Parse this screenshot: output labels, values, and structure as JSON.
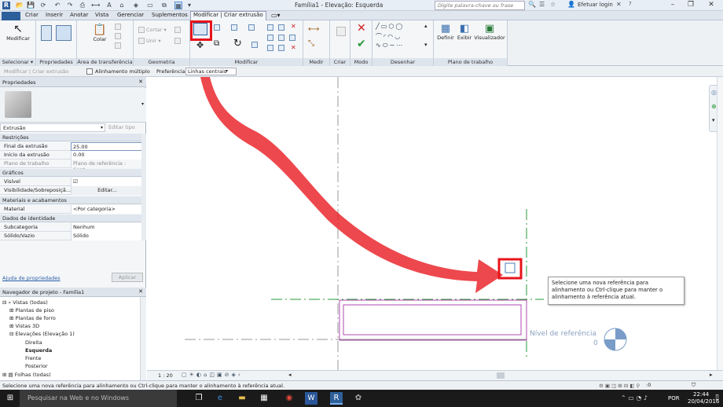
{
  "titlebar": {
    "title": "Família1 - Elevação: Esquerda",
    "search_placeholder": "Digite palavra-chave ou frase",
    "login": "Efetuar login",
    "help": "?"
  },
  "tabs": [
    "Criar",
    "Inserir",
    "Anotar",
    "Vista",
    "Gerenciar",
    "Suplementos",
    "Modificar | Criar extrusão"
  ],
  "ribbon": {
    "modificar": "Modificar",
    "selecionar": "Selecionar ▾",
    "propriedades": "Propriedades",
    "colar": "Colar",
    "transferencia": "Área de transferência",
    "cortar": "Cortar ▾",
    "unir": "Unir ▾",
    "geometria": "Geometria",
    "modificar_panel": "Modificar",
    "medir": "Medir",
    "criar": "Criar",
    "modo": "Modo",
    "desenhar": "Desenhar",
    "definir": "Definir",
    "exibir": "Exibir",
    "visualizador": "Visualizador",
    "plano": "Plano de trabalho"
  },
  "optionsbar": {
    "context": "Modificar | Criar extrusão",
    "multi_align": "Alinhamento múltiplo",
    "preference_label": "Preferência:",
    "preference_value": "Linhas centrais"
  },
  "properties": {
    "title": "Propriedades",
    "type": "Extrusão",
    "edit_type": "Editar tipo",
    "groups": {
      "restricoes": "Restrições",
      "graficos": "Gráficos",
      "materiais": "Materiais e acabamentos",
      "identidade": "Dados de identidade"
    },
    "rows": [
      {
        "k": "Final da extrusão",
        "v": "25.00"
      },
      {
        "k": "Início da extrusão",
        "v": "0.00"
      },
      {
        "k": "Plano de trabalho",
        "v": "Plano de referência : Cent..."
      },
      {
        "k": "Visível",
        "v": "☑"
      },
      {
        "k": "Visibilidade/Sobreposiçã...",
        "v": "Editar..."
      },
      {
        "k": "Material",
        "v": "<Por categoria>"
      },
      {
        "k": "Subcategoria",
        "v": "Nenhum"
      },
      {
        "k": "Sólido/Vazio",
        "v": "Sólido"
      }
    ],
    "help_link": "Ajuda de propriedades",
    "apply": "Aplicar"
  },
  "browser": {
    "title": "Navegador de projeto - Família1",
    "items": [
      "Vistas (todas)",
      "Plantas de piso",
      "Plantas de forro",
      "Vistas 3D",
      "Elevações (Elevação 1)",
      "Direita",
      "Esquerda",
      "Frente",
      "Posterior",
      "Folhas (todas)"
    ]
  },
  "canvas": {
    "level_name": "Nível de referência",
    "level_value": "0",
    "scale": "1 : 20",
    "tooltip": "Selecione uma nova referência para alinhamento ou Ctrl-clique para manter o alinhamento à referência atual."
  },
  "statusbar": {
    "text": "Selecione uma nova referência para alinhamento ou Ctrl-clique para manter o alinhamento à referência atual.",
    "selection_count": ":0"
  },
  "taskbar": {
    "search": "Pesquisar na Web e no Windows",
    "time": "22:44",
    "date": "20/04/2016",
    "lang": "POR"
  },
  "colors": {
    "annotation_red": "#e8141b",
    "purple_line": "#b04ab0",
    "green_line": "#2a9a3a"
  }
}
